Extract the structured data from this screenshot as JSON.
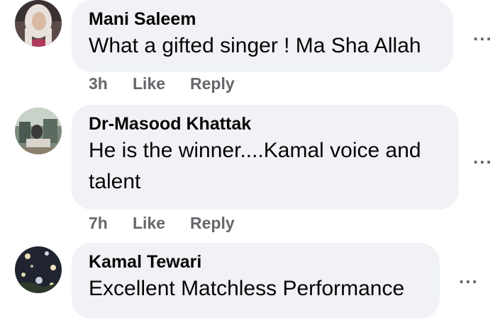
{
  "comments": [
    {
      "author": "Mani Saleem",
      "text": "What a gifted singer ! Ma Sha Allah",
      "time": "3h",
      "like_label": "Like",
      "reply_label": "Reply",
      "more_label": "..."
    },
    {
      "author": "Dr-Masood Khattak",
      "text": "He is the winner....Kamal voice and talent",
      "time": "7h",
      "like_label": "Like",
      "reply_label": "Reply",
      "more_label": "..."
    },
    {
      "author": "Kamal Tewari",
      "text": "Excellent Matchless Performance",
      "more_label": "..."
    }
  ],
  "colors": {
    "bubble_bg": "#f0f2f5",
    "secondary_text": "#65676b",
    "primary_text": "#050505"
  }
}
